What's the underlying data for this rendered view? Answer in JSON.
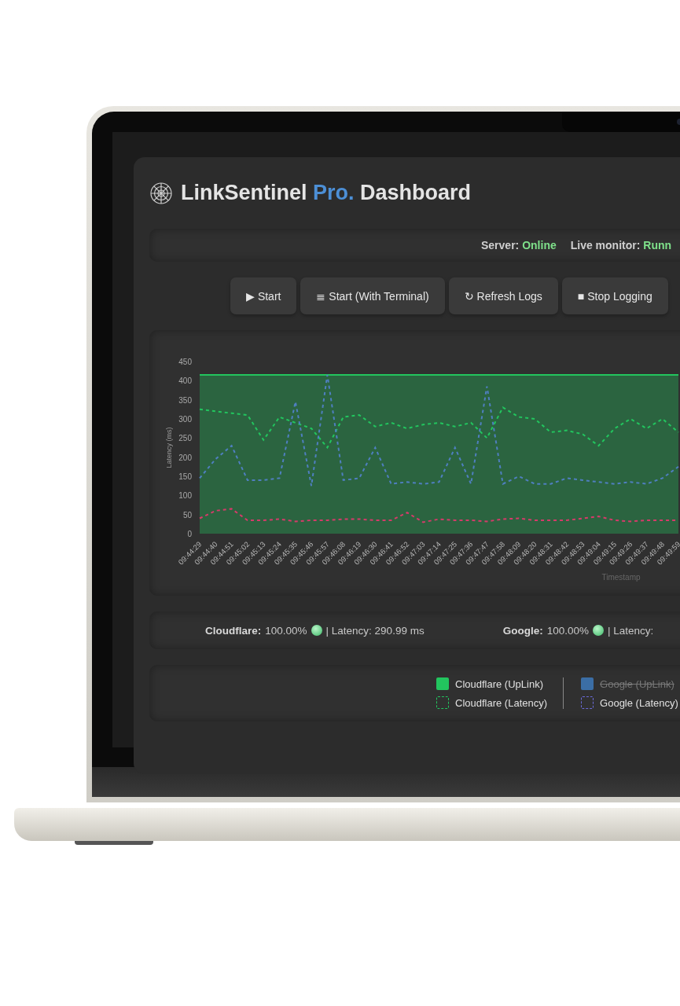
{
  "title": {
    "name": "LinkSentinel",
    "accent": "Pro.",
    "suffix": "Dashboard"
  },
  "status": [
    {
      "label": "Server:",
      "value": "Online"
    },
    {
      "label": "Live monitor:",
      "value": "Runn"
    }
  ],
  "buttons": [
    {
      "icon": "▶",
      "label": "Start"
    },
    {
      "icon": "≣",
      "label": "Start (With Terminal)"
    },
    {
      "icon": "↻",
      "label": "Refresh Logs"
    },
    {
      "icon": "■",
      "label": "Stop Logging"
    }
  ],
  "chart": {
    "chart_data": {
      "type": "line",
      "xlabel": "Timestamp",
      "ylabel": "Latency (ms)",
      "ylim": [
        0,
        450
      ],
      "yticks": [
        0,
        50,
        100,
        150,
        200,
        250,
        300,
        350,
        400,
        450
      ],
      "categories": [
        "09:44:29",
        "09:44:40",
        "09:44:51",
        "09:45:02",
        "09:45:13",
        "09:45:24",
        "09:45:35",
        "09:45:46",
        "09:45:57",
        "09:46:08",
        "09:46:19",
        "09:46:30",
        "09:46:41",
        "09:46:52",
        "09:47:03",
        "09:47:14",
        "09:47:25",
        "09:47:36",
        "09:47:47",
        "09:47:58",
        "09:48:09",
        "09:48:20",
        "09:48:31",
        "09:48:42",
        "09:48:53",
        "09:49:04",
        "09:49:15",
        "09:49:26",
        "09:49:37",
        "09:49:48",
        "09:49:59"
      ],
      "series": [
        {
          "color": "#22c55e",
          "type": "area",
          "values": [
            415,
            415,
            415,
            415,
            415,
            415,
            415,
            415,
            415,
            415,
            415,
            415,
            415,
            415,
            415,
            415,
            415,
            415,
            415,
            415,
            415,
            415,
            415,
            415,
            415,
            415,
            415,
            415,
            415,
            415,
            415
          ]
        },
        {
          "color": "#22c55e",
          "line_style": "dashed",
          "values": [
            325,
            320,
            315,
            310,
            245,
            305,
            290,
            275,
            225,
            305,
            310,
            280,
            290,
            275,
            285,
            290,
            280,
            290,
            250,
            330,
            305,
            300,
            265,
            270,
            260,
            230,
            275,
            300,
            275,
            300,
            265
          ]
        },
        {
          "color": "#4f7fc0",
          "line_style": "dashed",
          "values": [
            145,
            195,
            230,
            140,
            140,
            145,
            345,
            125,
            415,
            140,
            145,
            225,
            130,
            135,
            130,
            135,
            225,
            130,
            385,
            130,
            150,
            130,
            130,
            145,
            140,
            135,
            130,
            135,
            130,
            145,
            175
          ]
        },
        {
          "color": "#d63a6a",
          "line_style": "dashed",
          "values": [
            40,
            60,
            65,
            35,
            35,
            38,
            32,
            35,
            35,
            38,
            38,
            35,
            35,
            55,
            30,
            38,
            35,
            35,
            32,
            38,
            40,
            35,
            35,
            35,
            40,
            45,
            35,
            32,
            35,
            35,
            35
          ]
        }
      ]
    }
  },
  "stats": [
    {
      "name": "Cloudflare:",
      "uptime": "100.00%",
      "online": true,
      "latency": "| Latency: 290.99 ms"
    },
    {
      "name": "Google:",
      "uptime": "100.00%",
      "online": true,
      "latency": "| Latency:"
    }
  ],
  "legend": [
    [
      {
        "label": "Cloudflare (UpLink)",
        "kind": "fill",
        "color": "#22c55e",
        "hidden": false
      },
      {
        "label": "Cloudflare (Latency)",
        "kind": "dashed",
        "color": "#22c55e",
        "hidden": false
      }
    ],
    [
      {
        "label": "Google (UpLink)",
        "kind": "fill",
        "color": "#3b6ea5",
        "hidden": true
      },
      {
        "label": "Google (Latency)",
        "kind": "dashed",
        "color": "#6a6ad8",
        "hidden": false
      }
    ]
  ]
}
